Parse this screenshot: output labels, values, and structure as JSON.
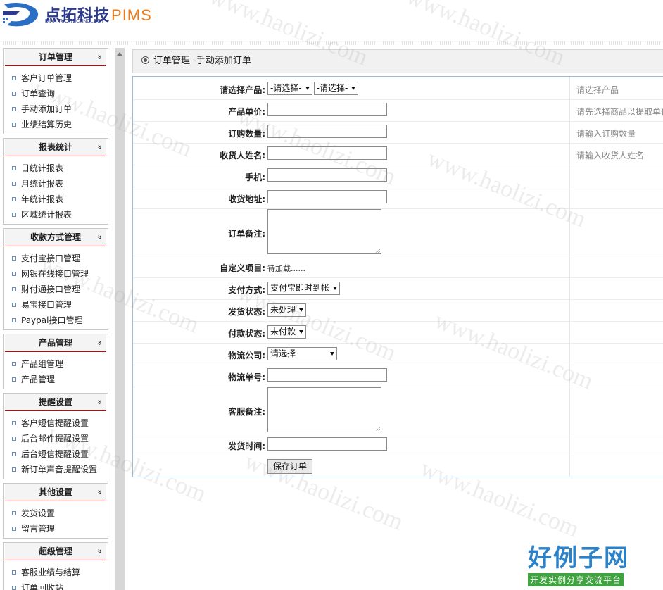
{
  "header": {
    "brand_cn": "点拓科技",
    "brand_pims": "PIMS",
    "brand_en": "DIAN TUO TECHNOLOGY"
  },
  "sidebar": {
    "groups": [
      {
        "title": "订单管理",
        "items": [
          "客户订单管理",
          "订单查询",
          "手动添加订单",
          "业绩结算历史"
        ]
      },
      {
        "title": "报表统计",
        "items": [
          "日统计报表",
          "月统计报表",
          "年统计报表",
          "区域统计报表"
        ]
      },
      {
        "title": "收款方式管理",
        "items": [
          "支付宝接口管理",
          "网银在线接口管理",
          "财付通接口管理",
          "易宝接口管理",
          "Paypal接口管理"
        ]
      },
      {
        "title": "产品管理",
        "items": [
          "产品组管理",
          "产品管理"
        ]
      },
      {
        "title": "提醒设置",
        "items": [
          "客户短信提醒设置",
          "后台邮件提醒设置",
          "后台短信提醒设置",
          "新订单声音提醒设置"
        ]
      },
      {
        "title": "其他设置",
        "items": [
          "发货设置",
          "留言管理"
        ]
      },
      {
        "title": "超级管理",
        "items": [
          "客服业绩与结算",
          "订单回收站"
        ]
      }
    ],
    "chevron": "»"
  },
  "main": {
    "title": "订单管理 -手动添加订单",
    "form": {
      "product_label": "请选择产品:",
      "product_select_1": "-请选择-",
      "product_select_2": "-请选择-",
      "product_hint": "请选择产品",
      "price_label": "产品单价:",
      "price_hint": "请先选择商品以提取单价",
      "qty_label": "订购数量:",
      "qty_hint": "请输入订购数量",
      "receiver_label": "收货人姓名:",
      "receiver_hint": "请输入收货人姓名",
      "phone_label": "手机:",
      "address_label": "收货地址:",
      "remark_label": "订单备注:",
      "custom_label": "自定义项目:",
      "custom_value": "待加载......",
      "payment_label": "支付方式:",
      "payment_value": "支付宝即时到帐",
      "ship_status_label": "发货状态:",
      "ship_status_value": "未处理",
      "pay_status_label": "付款状态:",
      "pay_status_value": "未付款",
      "logistics_label": "物流公司:",
      "logistics_value": "请选择",
      "tracking_label": "物流单号:",
      "service_remark_label": "客服备注:",
      "ship_time_label": "发货时间:",
      "save_button": "保存订单"
    }
  },
  "watermark": {
    "text": "www.haolizi.com",
    "site_big": "好例子网",
    "site_small": "开发实例分享交流平台"
  },
  "colors": {
    "brand_blue": "#2b3a8c",
    "brand_orange": "#e87a1a",
    "menu_underline": "#d40000",
    "form_border": "#9bbbd6"
  }
}
